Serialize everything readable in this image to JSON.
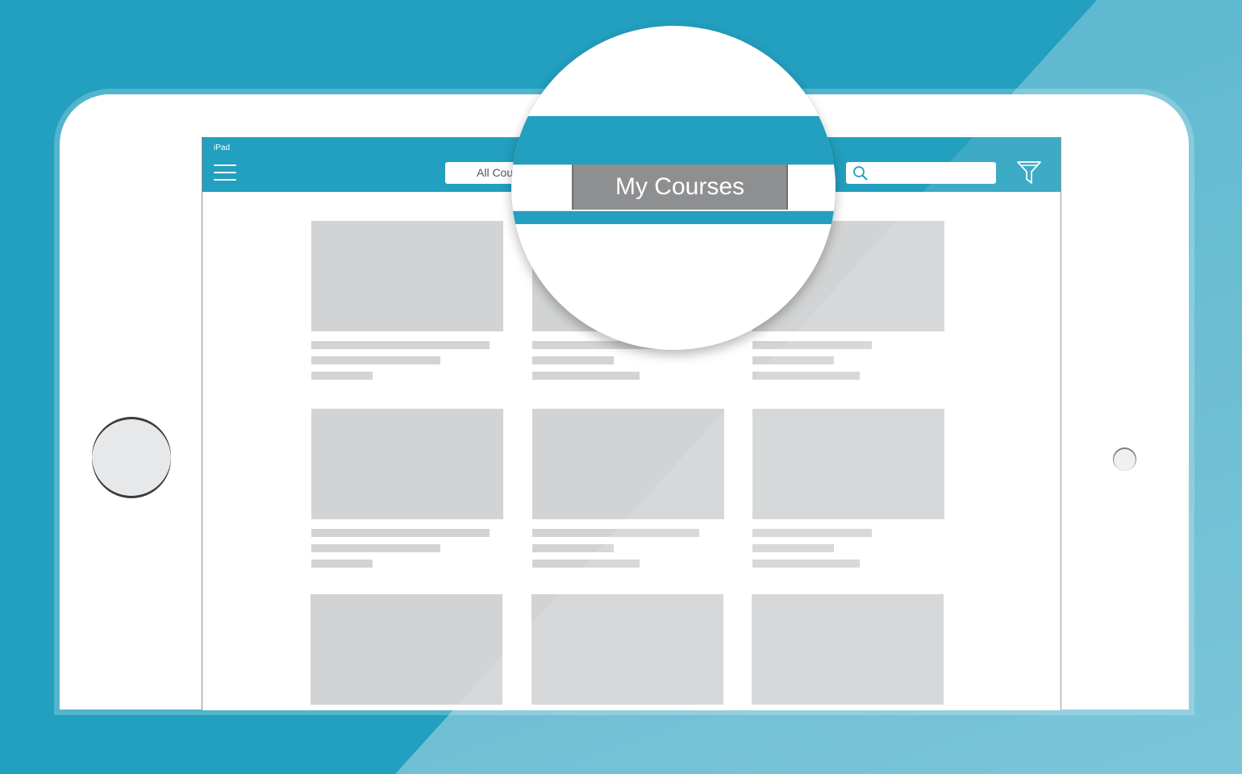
{
  "colors": {
    "accent": "#239fbf",
    "placeholder": "#d2d3d4",
    "selected_segment": "#8e8f91"
  },
  "device": {
    "status_label": "iPad"
  },
  "header": {
    "menu_icon": "hamburger-menu-icon",
    "course_selector_text": "All Cou",
    "search_icon": "search-icon",
    "filter_icon": "filter-funnel-icon"
  },
  "magnifier": {
    "selected_label": "My Courses"
  },
  "course_grid": {
    "rows": 3,
    "columns": 3
  }
}
